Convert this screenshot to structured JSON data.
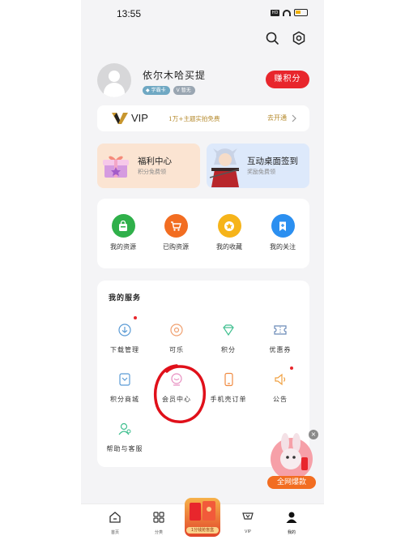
{
  "status_bar": {
    "time": "13:55",
    "network": "HD"
  },
  "profile": {
    "username": "依尔木哈买提",
    "badges": [
      "学霸卡",
      "暂无"
    ],
    "earn_button": "赚积分"
  },
  "vip_bar": {
    "logo_text": "VIP",
    "promo_text": "1万+主题实拍免费",
    "action_text": "去开通"
  },
  "promo_cards": [
    {
      "title": "福利中心",
      "subtitle": "积分免费领"
    },
    {
      "title": "互动桌面签到",
      "subtitle": "奖励免费领"
    }
  ],
  "favorites": [
    {
      "label": "我的资源",
      "color": "#2fb04a"
    },
    {
      "label": "已购资源",
      "color": "#f26d21"
    },
    {
      "label": "我的收藏",
      "color": "#f6b41a"
    },
    {
      "label": "我的关注",
      "color": "#2b8ff0"
    }
  ],
  "services": {
    "title": "我的服务",
    "items": [
      {
        "label": "下载管理",
        "icon": "download-icon"
      },
      {
        "label": "可乐",
        "icon": "cola-icon"
      },
      {
        "label": "积分",
        "icon": "points-icon"
      },
      {
        "label": "优惠券",
        "icon": "coupon-icon"
      },
      {
        "label": "积分商城",
        "icon": "points-mall-icon"
      },
      {
        "label": "会员中心",
        "icon": "member-center-icon"
      },
      {
        "label": "手机壳订单",
        "icon": "phone-case-icon"
      },
      {
        "label": "公告",
        "icon": "announcement-icon"
      },
      {
        "label": "帮助与客服",
        "icon": "help-icon"
      }
    ]
  },
  "floating_promo": {
    "label": "全网爆款",
    "close": "×"
  },
  "tab_bar": {
    "tabs": [
      "首页",
      "分类",
      "VIP",
      "我的"
    ],
    "center_label": "1分钱抢盲盒"
  },
  "colors": {
    "accent_red": "#e8262c",
    "annotation_red": "#e0101a"
  }
}
